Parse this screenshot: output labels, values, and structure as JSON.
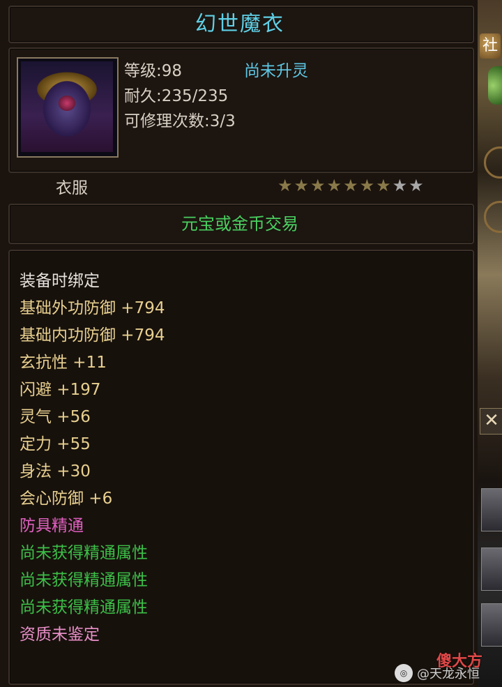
{
  "item": {
    "name": "幻世魔衣",
    "level_label": "等级:98",
    "spirit_status": "尚未升灵",
    "durability_label": "耐久:235/235",
    "repair_label": "可修理次数:3/3",
    "category": "衣服",
    "stars_total": 9,
    "stars_filled": 7,
    "trade": "元宝或金币交易",
    "attributes": {
      "bind": "装备时绑定",
      "ext_def": "基础外功防御 +794",
      "int_def": "基础内功防御 +794",
      "xuan_res": "玄抗性 +11",
      "dodge": "闪避 +197",
      "lingqi": "灵气 +56",
      "dingli": "定力 +55",
      "shenfa": "身法 +30",
      "crit_def": "会心防御 +6",
      "mastery_title": "防具精通",
      "mastery_1": "尚未获得精通属性",
      "mastery_2": "尚未获得精通属性",
      "mastery_3": "尚未获得精通属性",
      "quality": "资质未鉴定"
    }
  },
  "sidebar": {
    "badge_char": "社",
    "close_glyph": "✕"
  },
  "watermark": {
    "text": "@天龙永恒",
    "logo": "傻大方"
  },
  "colors": {
    "title": "#5fd0e6",
    "trade": "#4ad060",
    "star_filled": "#8a7a4a",
    "star_empty": "#a8a8a8"
  }
}
